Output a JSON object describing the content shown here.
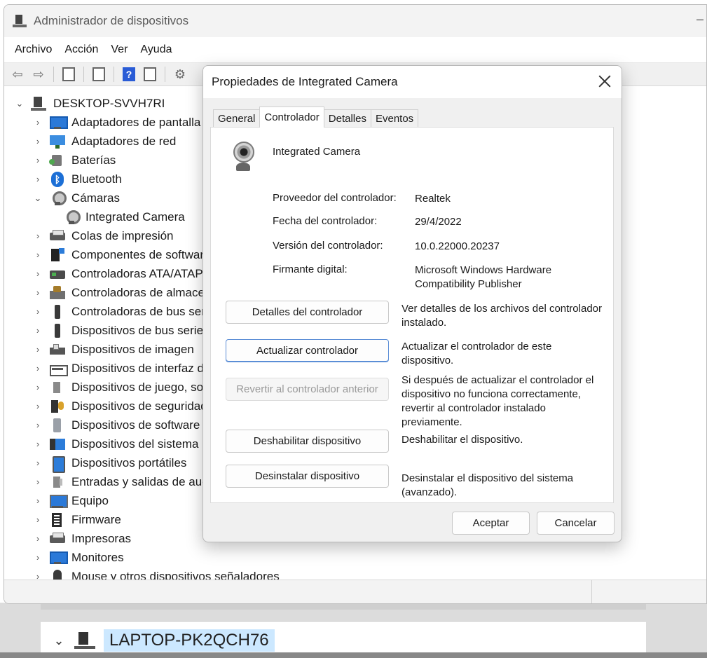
{
  "background_window": {
    "host_label": "LAPTOP-PK2QCH76"
  },
  "device_manager": {
    "title": "Administrador de dispositivos",
    "menu": [
      "Archivo",
      "Acción",
      "Ver",
      "Ayuda"
    ],
    "toolbar_icons": [
      "back-arrow-icon",
      "forward-arrow-icon",
      "properties-icon",
      "page-icon",
      "help-icon",
      "run-icon",
      "scan-hardware-icon"
    ],
    "tree": {
      "root": "DESKTOP-SVVH7RI",
      "items": [
        {
          "label": "Adaptadores de pantalla",
          "icon": "display-adapter-icon",
          "expanded": false
        },
        {
          "label": "Adaptadores de red",
          "icon": "network-adapter-icon",
          "expanded": false
        },
        {
          "label": "Baterías",
          "icon": "battery-icon",
          "expanded": false
        },
        {
          "label": "Bluetooth",
          "icon": "bluetooth-icon",
          "expanded": false
        },
        {
          "label": "Cámaras",
          "icon": "camera-icon",
          "expanded": true,
          "children": [
            "Integrated Camera"
          ]
        },
        {
          "label": "Colas de impresión",
          "icon": "print-queue-icon",
          "expanded": false
        },
        {
          "label": "Componentes de software",
          "icon": "software-component-icon",
          "expanded": false
        },
        {
          "label": "Controladoras ATA/ATAPI IDE",
          "icon": "ata-controller-icon",
          "expanded": false
        },
        {
          "label": "Controladoras de almacenamiento",
          "icon": "storage-controller-icon",
          "expanded": false
        },
        {
          "label": "Controladoras de bus serie universal",
          "icon": "usb-controller-icon",
          "expanded": false
        },
        {
          "label": "Dispositivos de bus serie universal",
          "icon": "usb-device-icon",
          "expanded": false
        },
        {
          "label": "Dispositivos de imagen",
          "icon": "imaging-device-icon",
          "expanded": false
        },
        {
          "label": "Dispositivos de interfaz de usuario",
          "icon": "hid-icon",
          "expanded": false
        },
        {
          "label": "Dispositivos de juego, sonido y vídeo",
          "icon": "sound-icon",
          "expanded": false
        },
        {
          "label": "Dispositivos de seguridad",
          "icon": "security-device-icon",
          "expanded": false
        },
        {
          "label": "Dispositivos de software",
          "icon": "software-device-icon",
          "expanded": false
        },
        {
          "label": "Dispositivos del sistema",
          "icon": "system-device-icon",
          "expanded": false
        },
        {
          "label": "Dispositivos portátiles",
          "icon": "portable-device-icon",
          "expanded": false
        },
        {
          "label": "Entradas y salidas de audio",
          "icon": "audio-io-icon",
          "expanded": false
        },
        {
          "label": "Equipo",
          "icon": "computer-icon",
          "expanded": false
        },
        {
          "label": "Firmware",
          "icon": "firmware-icon",
          "expanded": false
        },
        {
          "label": "Impresoras",
          "icon": "printer-icon",
          "expanded": false
        },
        {
          "label": "Monitores",
          "icon": "monitor-icon",
          "expanded": false
        },
        {
          "label": "Mouse y otros dispositivos señaladores",
          "icon": "mouse-icon",
          "expanded": false
        }
      ]
    }
  },
  "dialog": {
    "title": "Propiedades de Integrated Camera",
    "tabs": [
      {
        "label": "General",
        "active": false
      },
      {
        "label": "Controlador",
        "active": true
      },
      {
        "label": "Detalles",
        "active": false
      },
      {
        "label": "Eventos",
        "active": false
      }
    ],
    "device_name": "Integrated Camera",
    "properties": [
      {
        "label": "Proveedor del controlador:",
        "value": "Realtek"
      },
      {
        "label": "Fecha del controlador:",
        "value": "29/4/2022"
      },
      {
        "label": "Versión del controlador:",
        "value": "10.0.22000.20237"
      },
      {
        "label": "Firmante digital:",
        "value": "Microsoft Windows Hardware Compatibility Publisher"
      }
    ],
    "actions": [
      {
        "label": "Detalles del controlador",
        "description": "Ver detalles de los archivos del controlador instalado.",
        "state": "enabled"
      },
      {
        "label": "Actualizar controlador",
        "description": "Actualizar el controlador de este dispositivo.",
        "state": "focused"
      },
      {
        "label": "Revertir al controlador anterior",
        "description": "Si después de actualizar el controlador el dispositivo no funciona correctamente, revertir al controlador instalado previamente.",
        "state": "disabled"
      },
      {
        "label": "Deshabilitar dispositivo",
        "description": "Deshabilitar el dispositivo.",
        "state": "enabled"
      },
      {
        "label": "Desinstalar dispositivo",
        "description": "Desinstalar el dispositivo del sistema (avanzado).",
        "state": "enabled"
      }
    ],
    "ok_label": "Aceptar",
    "cancel_label": "Cancelar"
  },
  "colors": {
    "accent": "#5b8ed6",
    "selection": "#cce8ff",
    "dialog_bg": "#f0f0f0"
  }
}
